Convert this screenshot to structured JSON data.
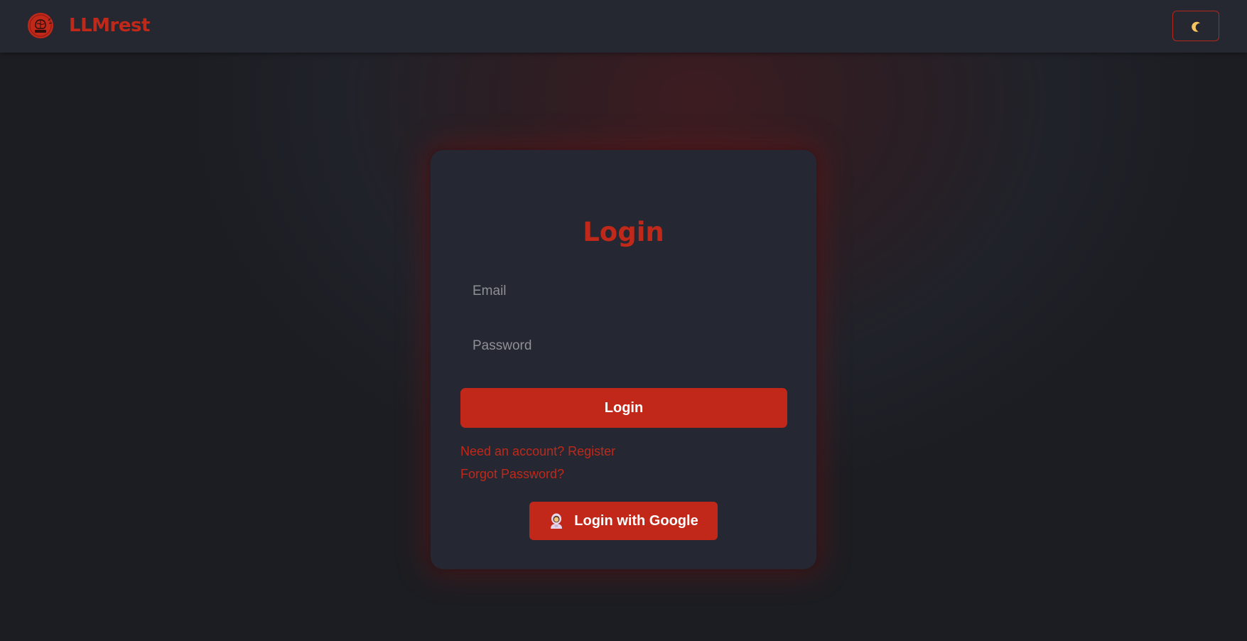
{
  "header": {
    "brand": "LLMrest",
    "logo_icon": "brain-logo-icon",
    "theme_toggle_icon": "moon-icon"
  },
  "login": {
    "title": "Login",
    "email_placeholder": "Email",
    "password_placeholder": "Password",
    "submit_label": "Login",
    "register_link": "Need an account? Register",
    "forgot_link": "Forgot Password?",
    "google_label": "Login with Google",
    "google_icon": "astronaut-icon"
  },
  "colors": {
    "accent": "#c1281a",
    "card": "#252832",
    "topbar": "#252831",
    "background": "#1c1d22"
  }
}
